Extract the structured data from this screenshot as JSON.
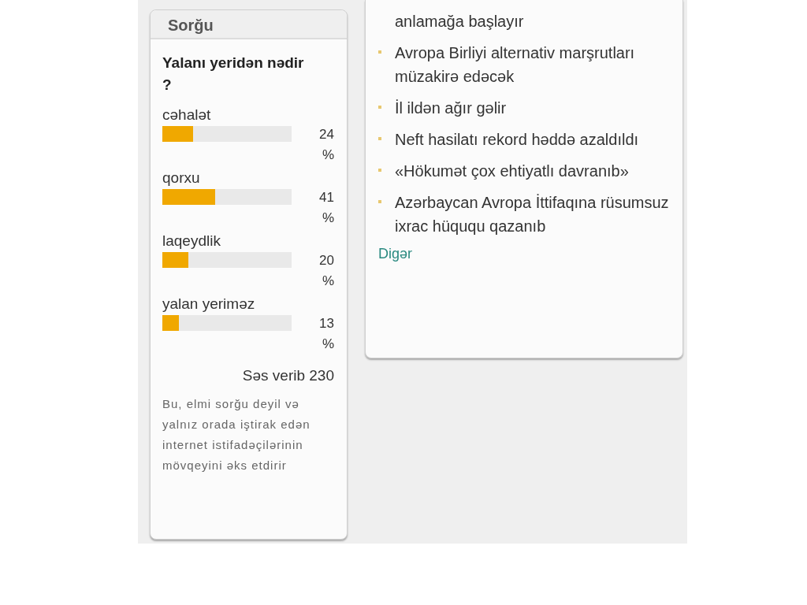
{
  "poll": {
    "title": "Sorğu",
    "question": "Yalanı yeridən nədir ?",
    "options": [
      {
        "label": "cəhalət",
        "level": 0.24,
        "percent": "24",
        "unit": "%"
      },
      {
        "label": "qorxu",
        "level": 0.41,
        "percent": "41",
        "unit": "%"
      },
      {
        "label": "laqeydlik",
        "level": 0.2,
        "percent": "20",
        "unit": "%"
      },
      {
        "label": "yalan yeriməz",
        "level": 0.13,
        "percent": "13",
        "unit": "%"
      }
    ],
    "votes": "Səs verib 230",
    "disclaimer": "Bu, elmi sorğu deyil və yalnız orada iştirak edən internet istifadəçilərinin mövqeyini əks etdirir"
  },
  "news": {
    "items": [
      {
        "kind": "continued",
        "text": "anlamağa başlayır"
      },
      {
        "kind": "item",
        "text": "Avropa Birliyi alternativ marşrutları müzakirə edəcək"
      },
      {
        "kind": "item",
        "text": "İl ildən ağır gəlir"
      },
      {
        "kind": "item",
        "text": "Neft hasilatı rekord həddə azaldıldı"
      },
      {
        "kind": "item",
        "text": "«Hökumət çox ehtiyatlı davranıb»"
      },
      {
        "kind": "item",
        "text": "Azərbaycan Avropa İttifaqına rüsumsuz ixrac hüququ qazanıb"
      }
    ],
    "more": "Digər"
  }
}
